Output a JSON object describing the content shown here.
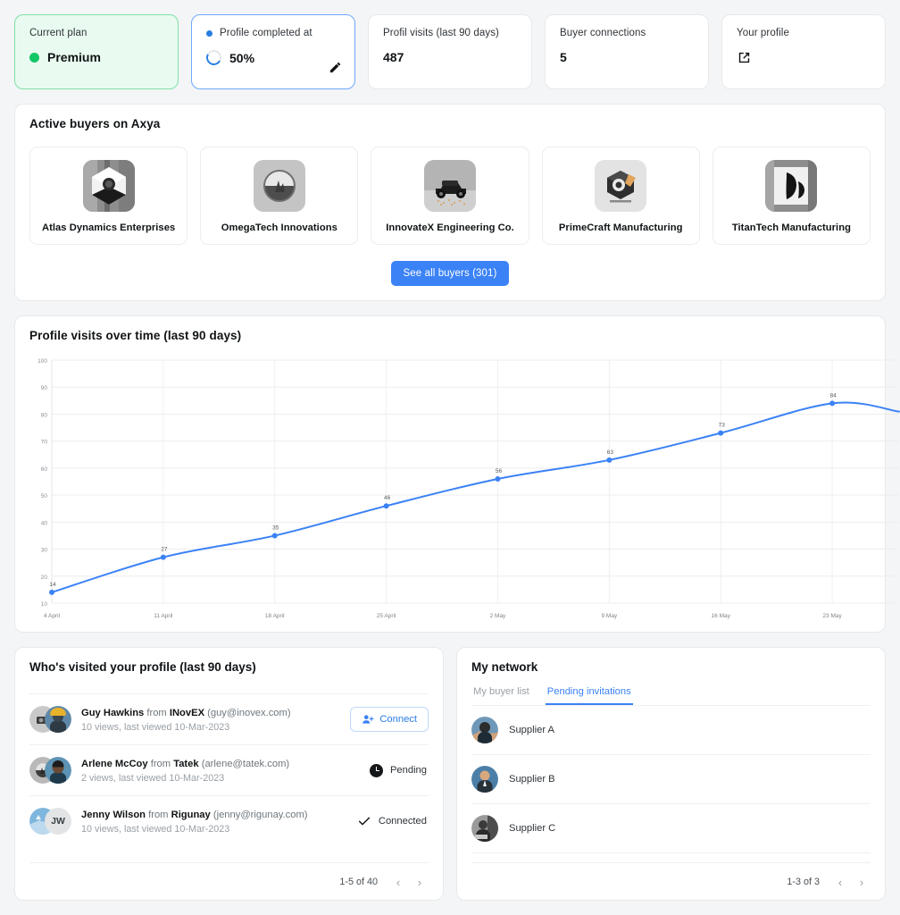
{
  "stats": [
    {
      "label": "Current plan",
      "value": "Premium",
      "icon": "green-dot",
      "style": "plan"
    },
    {
      "label": "Profile completed at",
      "value": "50%",
      "icon": "progress-ring",
      "style": "profile-complete",
      "progress": 50,
      "action_icon": "pencil-icon"
    },
    {
      "label": "Profil visits (last 90 days)",
      "value": "487",
      "icon": "",
      "style": "plain"
    },
    {
      "label": "Buyer connections",
      "value": "5",
      "icon": "",
      "style": "plain"
    },
    {
      "label": "Your profile",
      "value": "",
      "icon": "external-link-icon",
      "style": "plain"
    }
  ],
  "buyers": {
    "title": "Active buyers on Axya",
    "see_all_label": "See all buyers (301)",
    "items": [
      {
        "name": "Atlas Dynamics Enterprises",
        "logo": "hexagon-logo"
      },
      {
        "name": "OmegaTech Innovations",
        "logo": "circle-badge-logo"
      },
      {
        "name": "InnovateX Engineering Co.",
        "logo": "vehicle-logo"
      },
      {
        "name": "PrimeCraft Manufacturing",
        "logo": "cube-logo"
      },
      {
        "name": "TitanTech Manufacturing",
        "logo": "leaf-logo"
      }
    ]
  },
  "chart_data": {
    "type": "line",
    "title": "Profile visits over time (last 90 days)",
    "xlabel": "",
    "ylabel": "",
    "categories": [
      "4 April",
      "11 April",
      "18 April",
      "25 April",
      "2 May",
      "9 May",
      "16 May",
      "23 May"
    ],
    "values": [
      14,
      27,
      35,
      46,
      56,
      63,
      73,
      84
    ],
    "point_labels": [
      "14",
      "27",
      "35",
      "46",
      "56",
      "63",
      "73",
      "84"
    ],
    "ylim": [
      10,
      100
    ],
    "yticks": [
      10,
      20,
      30,
      40,
      50,
      60,
      70,
      80,
      90,
      100
    ],
    "grid": true,
    "legend": false,
    "line_color": "#3b82f6",
    "point_color": "#3b82f6"
  },
  "visitors": {
    "title": "Who's visited your profile (last 90 days)",
    "rows": [
      {
        "name": "Guy Hawkins",
        "from_label": "from",
        "company": "INovEX",
        "email": "(guy@inovex.com)",
        "meta": "10 views, last viewed 10-Mar-2023",
        "action_type": "connect",
        "action_label": "Connect",
        "avatar_initials": ""
      },
      {
        "name": "Arlene McCoy",
        "from_label": "from",
        "company": "Tatek",
        "email": "(arlene@tatek.com)",
        "meta": "2 views, last viewed 10-Mar-2023",
        "action_type": "pending",
        "action_label": "Pending",
        "avatar_initials": ""
      },
      {
        "name": "Jenny Wilson",
        "from_label": "from",
        "company": "Rigunay",
        "email": "(jenny@rigunay.com)",
        "meta": "10 views, last viewed 10-Mar-2023",
        "action_type": "connected",
        "action_label": "Connected",
        "avatar_initials": "JW"
      }
    ],
    "pager": {
      "label": "1-5 of 40",
      "prev": "‹",
      "next": "›"
    }
  },
  "network": {
    "title": "My network",
    "tabs": [
      {
        "label": "My buyer list",
        "active": false
      },
      {
        "label": "Pending invitations",
        "active": true
      }
    ],
    "rows": [
      {
        "name": "Supplier A"
      },
      {
        "name": "Supplier B"
      },
      {
        "name": "Supplier C"
      }
    ],
    "pager": {
      "label": "1-3 of 3",
      "prev": "‹",
      "next": "›"
    }
  },
  "colors": {
    "accent": "#3b82f6",
    "plan_bg": "#e9fbf0",
    "plan_border": "#7fe0a8",
    "plan_dot": "#14c766",
    "page_bg": "#f4f5f6"
  }
}
